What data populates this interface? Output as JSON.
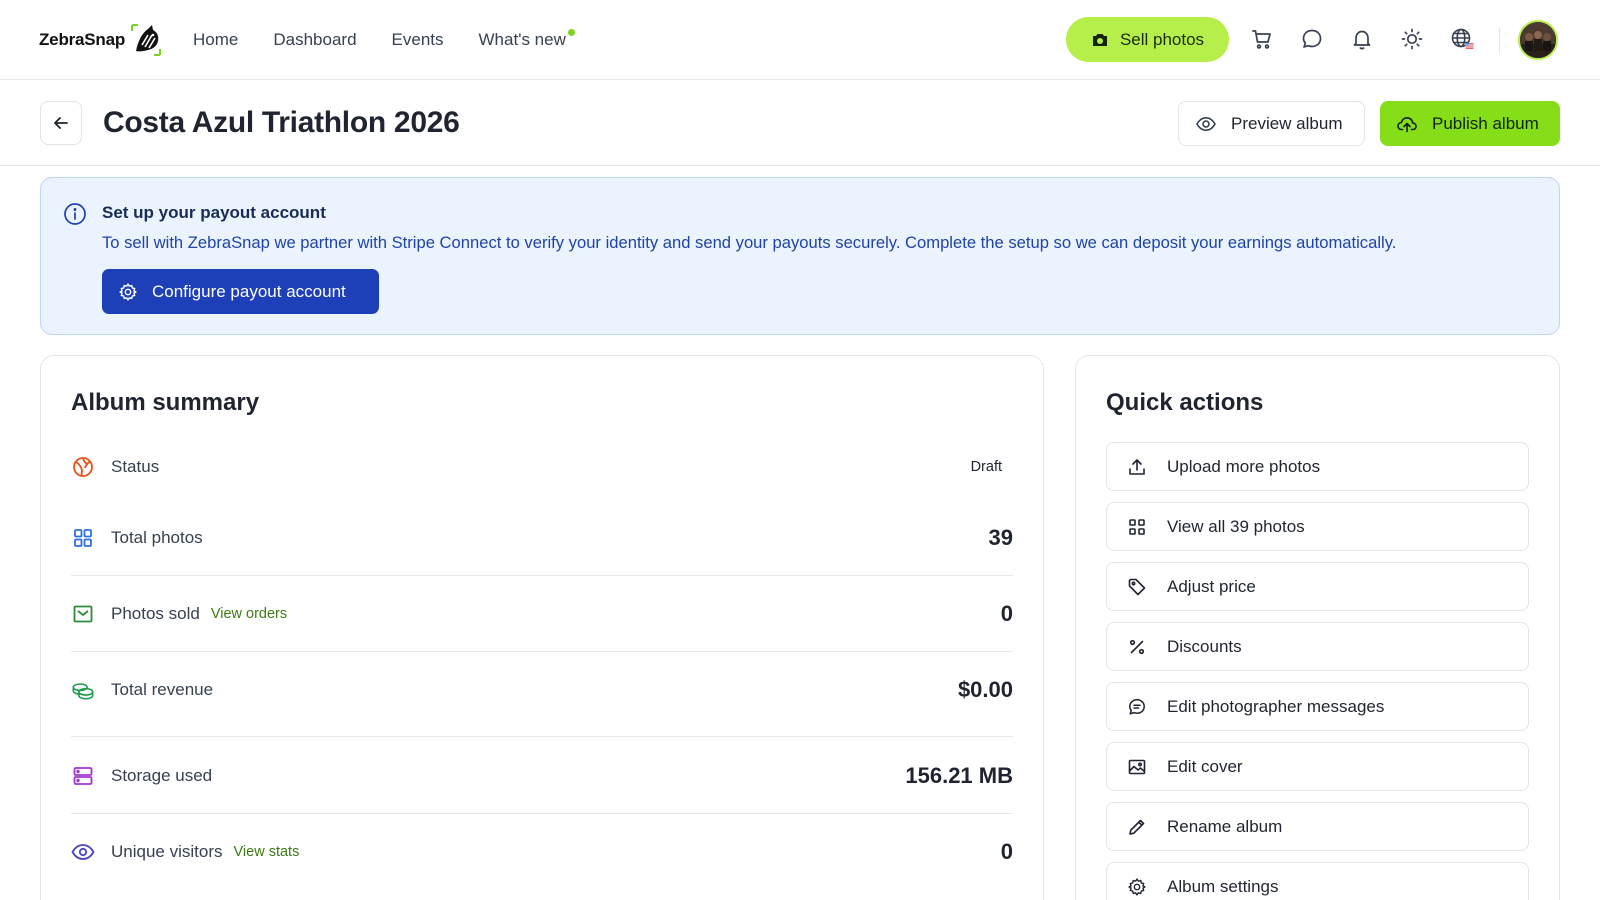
{
  "brand": {
    "name": "ZebraSnap"
  },
  "nav": {
    "items": [
      {
        "label": "Home"
      },
      {
        "label": "Dashboard"
      },
      {
        "label": "Events"
      },
      {
        "label": "What's new",
        "has_dot": true
      }
    ],
    "sell_label": "Sell photos",
    "icons": [
      "cart-icon",
      "chat-icon",
      "bell-icon",
      "sun-icon",
      "globe-icon"
    ]
  },
  "header": {
    "title": "Costa Azul Triathlon 2026",
    "preview_label": "Preview album",
    "publish_label": "Publish album"
  },
  "alert": {
    "title": "Set up your payout account",
    "body": "To sell with ZebraSnap we partner with Stripe Connect to verify your identity and send your payouts securely. Complete the setup so we can deposit your earnings automatically.",
    "button_label": "Configure payout account"
  },
  "summary": {
    "title": "Album summary",
    "rows": [
      {
        "label": "Status",
        "value": "Draft",
        "icon": "status-icon"
      },
      {
        "label": "Total photos",
        "value": "39",
        "icon": "grid-icon"
      },
      {
        "label": "Photos sold",
        "link": "View orders",
        "value": "0",
        "icon": "inbox-icon"
      },
      {
        "label": "Total revenue",
        "value": "$0.00",
        "icon": "coins-icon"
      },
      {
        "label": "Storage used",
        "value": "156.21 MB",
        "icon": "storage-icon"
      },
      {
        "label": "Unique visitors",
        "link": "View stats",
        "value": "0",
        "icon": "eye-icon"
      }
    ]
  },
  "quick_actions": {
    "title": "Quick actions",
    "items": [
      {
        "label": "Upload more photos",
        "icon": "upload-icon"
      },
      {
        "label": "View all 39 photos",
        "icon": "grid-icon"
      },
      {
        "label": "Adjust price",
        "icon": "tag-icon"
      },
      {
        "label": "Discounts",
        "icon": "percent-icon"
      },
      {
        "label": "Edit photographer messages",
        "icon": "message-icon"
      },
      {
        "label": "Edit cover",
        "icon": "image-icon"
      },
      {
        "label": "Rename album",
        "icon": "pencil-icon"
      },
      {
        "label": "Album settings",
        "icon": "gear-icon"
      }
    ]
  },
  "colors": {
    "accent_green": "#86de18",
    "sell_green": "#b6ef4a",
    "alert_bg": "#eaf3fe",
    "alert_button": "#1d3fb8",
    "link_green": "#3d7a14"
  }
}
